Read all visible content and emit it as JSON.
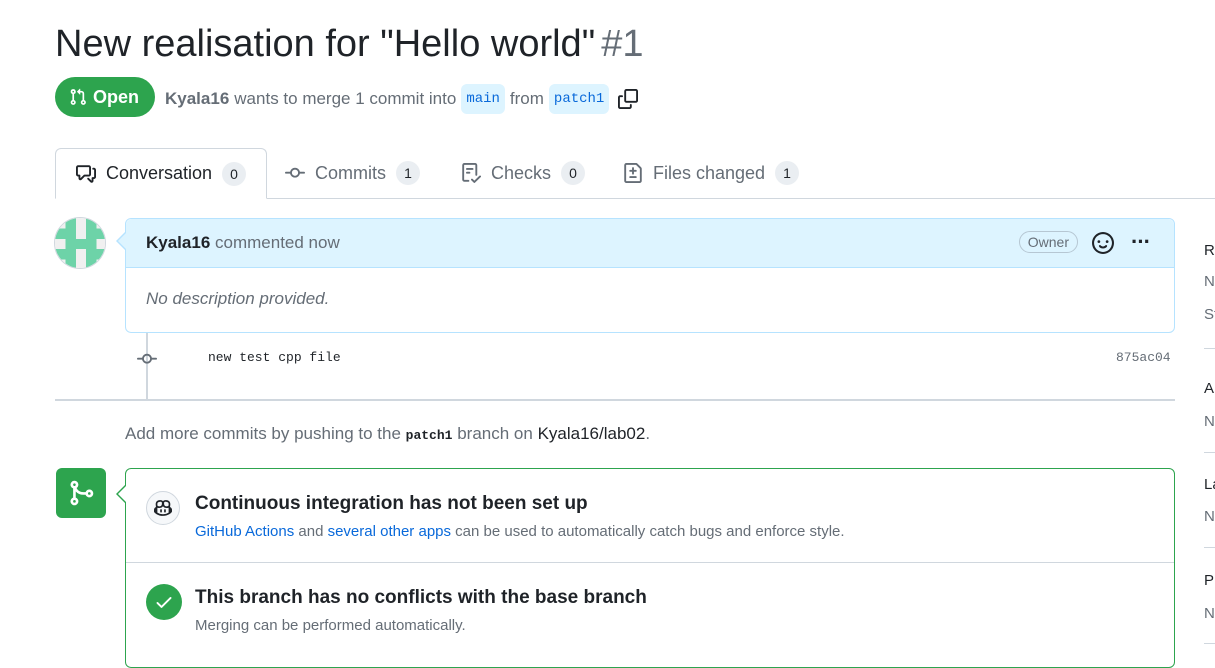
{
  "pr": {
    "title": "New realisation for \"Hello world\"",
    "number": "#1",
    "state": "Open",
    "author": "Kyala16",
    "merge_text": "wants to merge 1 commit into",
    "base_branch": "main",
    "from_text": "from",
    "head_branch": "patch1"
  },
  "tabs": [
    {
      "label": "Conversation",
      "count": "0"
    },
    {
      "label": "Commits",
      "count": "1"
    },
    {
      "label": "Checks",
      "count": "0"
    },
    {
      "label": "Files changed",
      "count": "1"
    }
  ],
  "comment": {
    "author": "Kyala16",
    "action": "commented now",
    "role_badge": "Owner",
    "body": "No description provided."
  },
  "commit": {
    "message": "new test cpp file",
    "sha": "875ac04"
  },
  "push_hint": {
    "prefix": "Add more commits by pushing to the",
    "branch": "patch1",
    "middle": "branch on",
    "repo": "Kyala16/lab02",
    "suffix": "."
  },
  "merge_box": {
    "ci_title": "Continuous integration has not been set up",
    "ci_link1": "GitHub Actions",
    "ci_and": "and",
    "ci_link2": "several other apps",
    "ci_rest": "can be used to automatically catch bugs and enforce style.",
    "conflict_title": "This branch has no conflicts with the base branch",
    "conflict_sub": "Merging can be performed automatically."
  },
  "sidebar": {
    "items": [
      "Re",
      "N",
      "St",
      "A",
      "N",
      "La",
      "N",
      "Pr",
      "N"
    ]
  },
  "colors": {
    "open_green": "#2da44e",
    "link_blue": "#0969da",
    "comment_header_bg": "#ddf4ff"
  }
}
